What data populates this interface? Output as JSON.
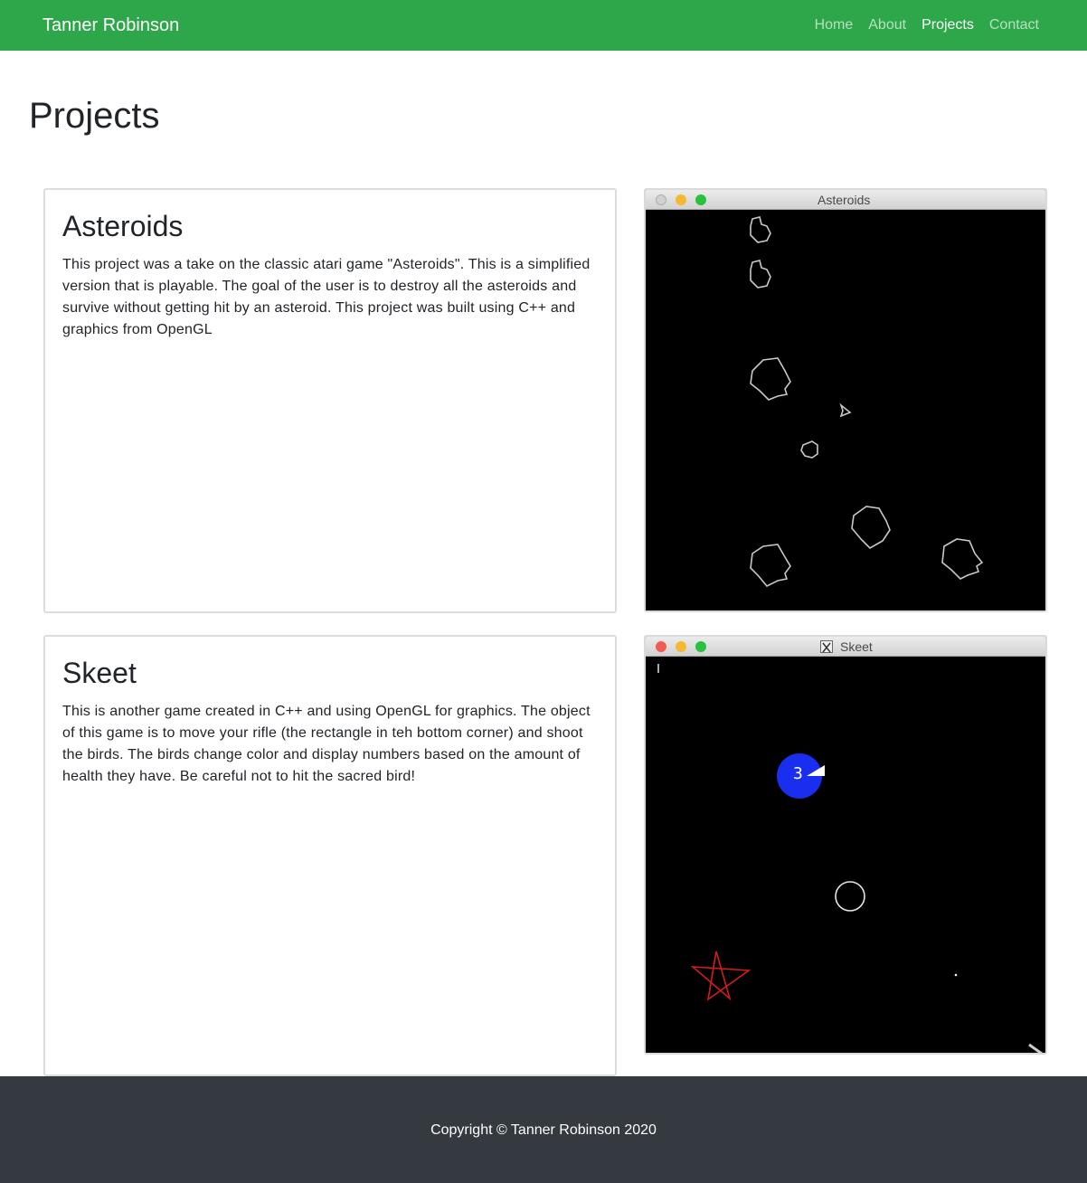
{
  "navbar": {
    "brand": "Tanner Robinson",
    "links": [
      {
        "label": "Home",
        "active": false
      },
      {
        "label": "About",
        "active": false
      },
      {
        "label": "Projects",
        "active": true
      },
      {
        "label": "Contact",
        "active": false
      }
    ],
    "bg_color": "#2ea74a"
  },
  "page": {
    "title": "Projects"
  },
  "projects": [
    {
      "title": "Asteroids",
      "description": "This project was a take on the classic atari game \"Asteroids\". This is a simplified version that is playable. The goal of the user is to destroy all the asteroids and survive without getting hit by an asteroid. This project was built using C++ and graphics from OpenGL",
      "window_title": "Asteroids"
    },
    {
      "title": "Skeet",
      "description": "This is another game created in C++ and using OpenGL for graphics. The object of this game is to move your rifle (the rectangle in teh bottom corner) and shoot the birds. The birds change color and display numbers based on the amount of health they have. Be careful not to hit the sacred bird!",
      "window_title": "Skeet",
      "bird_health": "3"
    }
  ],
  "footer": {
    "text": "Copyright © Tanner Robinson 2020",
    "bg_color": "#343a40"
  }
}
